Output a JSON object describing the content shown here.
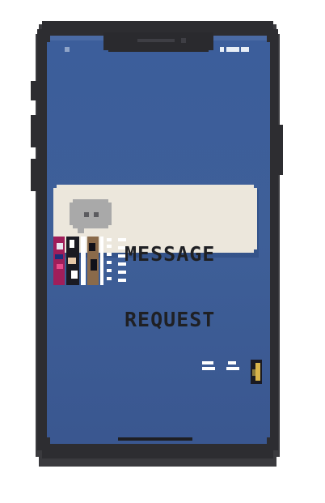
{
  "notification": {
    "title_line1": "MESSAGE",
    "title_line2": "REQUEST",
    "icon": "chat-bubble-icon"
  },
  "colors": {
    "screen_blue": "#3e5f9a",
    "bezel": "#2f2f33",
    "card": "#ece7dc",
    "icon_gray": "#a9a9a9",
    "text": "#1f2024"
  }
}
